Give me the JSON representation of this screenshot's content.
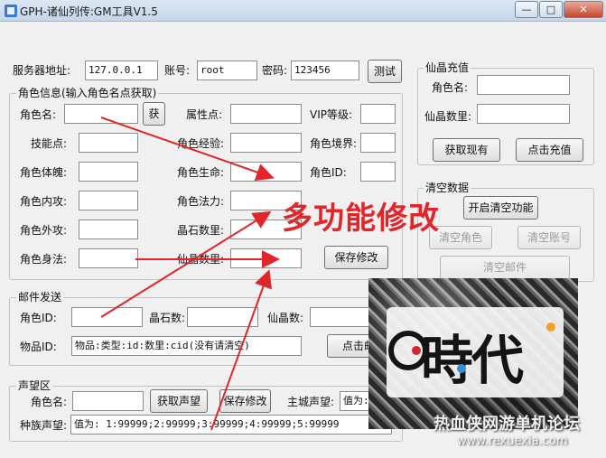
{
  "window": {
    "title": "GPH-诸仙列传:GM工具V1.5",
    "minimize_glyph": "—",
    "maximize_glyph": "□",
    "close_glyph": "✕"
  },
  "server": {
    "address_label": "服务器地址:",
    "address_value": "127.0.0.1",
    "account_label": "账号:",
    "account_value": "root",
    "password_label": "密码:",
    "password_value": "123456",
    "test_button": "测试"
  },
  "role_info": {
    "group_title": "角色信息(输入角色名点获取)",
    "name_label": "角色名:",
    "name_value": "",
    "get_button": "获",
    "attr_points_label": "属性点:",
    "vip_label": "VIP等级:",
    "skill_points_label": "技能点:",
    "exp_label": "角色经验:",
    "realm_label": "角色境界:",
    "physique_label": "角色体魄:",
    "life_label": "角色生命:",
    "id_label": "角色ID:",
    "inner_attack_label": "角色内攻:",
    "mana_label": "角色法力:",
    "outer_attack_label": "角色外攻:",
    "crystal_label": "晶石数里:",
    "agility_label": "角色身法:",
    "jade_label": "仙晶数里:",
    "save_button": "保存修改"
  },
  "recharge": {
    "group_title": "仙晶充值",
    "name_label": "角色名:",
    "amount_label": "仙晶数里:",
    "fetch_button": "获取现有",
    "recharge_button": "点击充值"
  },
  "clear_data": {
    "group_title": "清空数据",
    "enable_button": "开启清空功能",
    "clear_role_button": "清空角色",
    "clear_account_button": "清空账号",
    "clear_mail_button": "清空邮件"
  },
  "mail": {
    "group_title": "邮件发送",
    "role_id_label": "角色ID:",
    "crystal_label": "晶石数:",
    "jade_label": "仙晶数:",
    "item_id_label": "物品ID:",
    "item_id_value": "物品:类型:id:数里:cid(没有请清空)",
    "send_button": "点击邮"
  },
  "reputation": {
    "group_title": "声望区",
    "name_label": "角色名:",
    "get_button": "获取声望",
    "save_button": "保存修改",
    "city_label": "主城声望:",
    "city_value": "值为:",
    "race_label": "种族声望:",
    "race_value": "值为: 1:99999;2:99999;3:99999;4:99999;5:99999"
  },
  "overlay": {
    "annotation": "多功能修改",
    "logo_text": "時代",
    "watermark_1": "热血侠网游单机论坛",
    "watermark_2": "www.rexuexia.com",
    "arrow_color": "#e0262b"
  }
}
